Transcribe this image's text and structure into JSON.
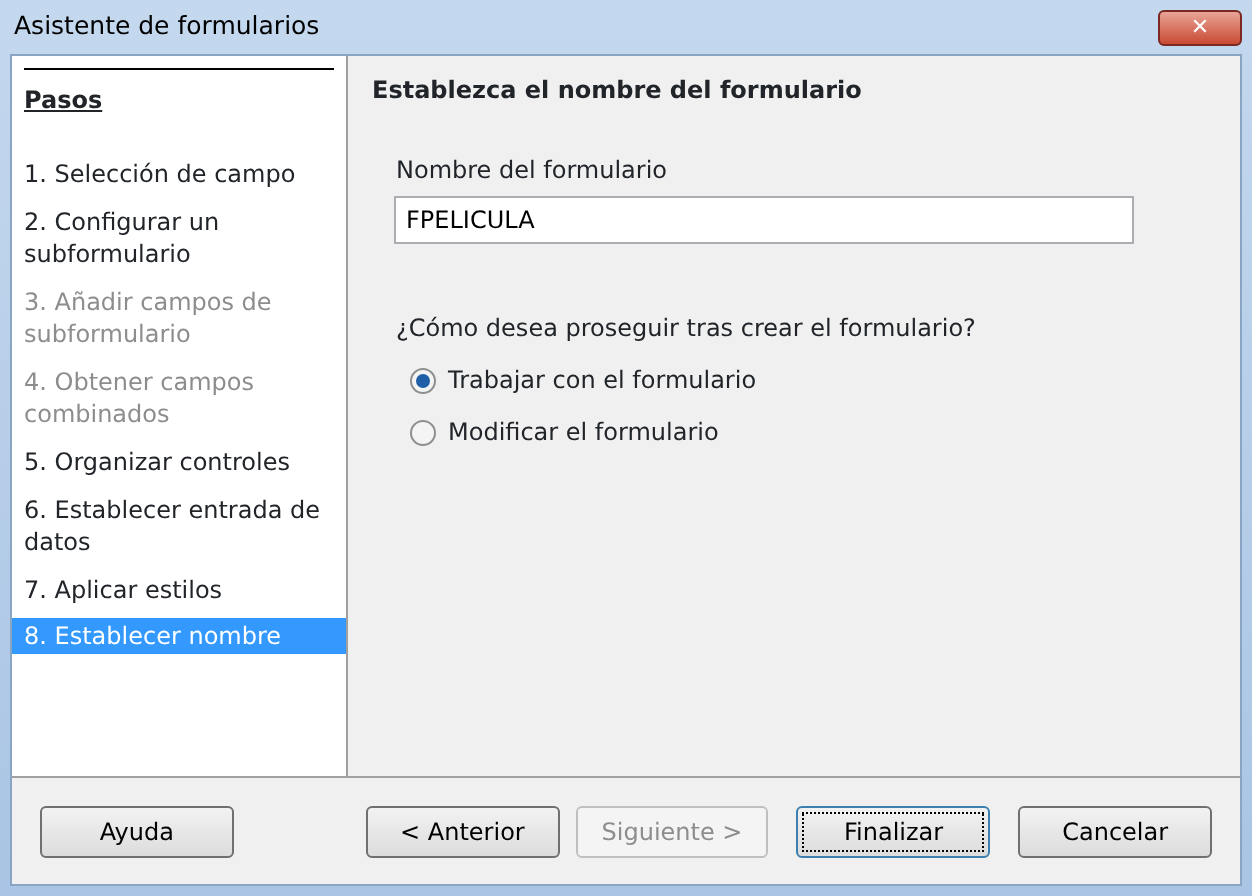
{
  "window": {
    "title": "Asistente de formularios",
    "close": "✕"
  },
  "sidebar": {
    "heading": "Pasos",
    "items": [
      {
        "label": "1. Selección de campo",
        "disabled": false,
        "selected": false
      },
      {
        "label": "2. Configurar un subformulario",
        "disabled": false,
        "selected": false
      },
      {
        "label": "3. Añadir campos de subformulario",
        "disabled": true,
        "selected": false
      },
      {
        "label": "4. Obtener campos combinados",
        "disabled": true,
        "selected": false
      },
      {
        "label": "5. Organizar controles",
        "disabled": false,
        "selected": false
      },
      {
        "label": "6. Establecer entrada de datos",
        "disabled": false,
        "selected": false
      },
      {
        "label": "7. Aplicar estilos",
        "disabled": false,
        "selected": false
      },
      {
        "label": "8. Establecer nombre",
        "disabled": false,
        "selected": true
      }
    ]
  },
  "content": {
    "heading": "Establezca el nombre del formulario",
    "name_label": "Nombre del formulario",
    "name_value": "FPELICULA",
    "question": "¿Cómo desea proseguir tras crear el formulario?",
    "options": [
      {
        "label": "Trabajar con el formulario",
        "selected": true
      },
      {
        "label": "Modificar el formulario",
        "selected": false
      }
    ]
  },
  "buttons": [
    {
      "label": "Ayuda",
      "disabled": false,
      "default": false
    },
    {
      "label": "< Anterior",
      "disabled": false,
      "default": false
    },
    {
      "label": "Siguiente >",
      "disabled": true,
      "default": false
    },
    {
      "label": "Finalizar",
      "disabled": false,
      "default": true
    },
    {
      "label": "Cancelar",
      "disabled": false,
      "default": false
    }
  ]
}
